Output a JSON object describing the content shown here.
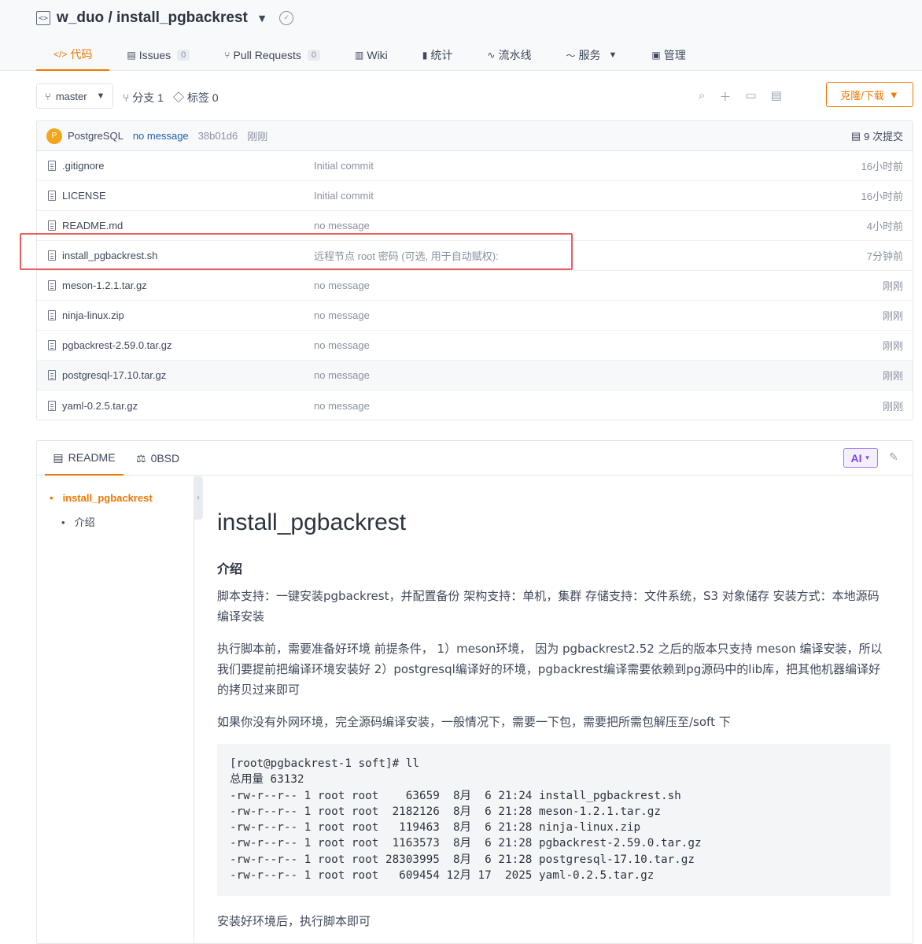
{
  "repo": {
    "title": "w_duo / install_pgbackrest"
  },
  "tabs": [
    {
      "label": "代码",
      "icon": "code-icon"
    },
    {
      "label": "Issues",
      "count": "0",
      "icon": "issue-icon"
    },
    {
      "label": "Pull Requests",
      "count": "0",
      "icon": "pull-request-icon"
    },
    {
      "label": "Wiki",
      "icon": "wiki-icon"
    },
    {
      "label": "统计",
      "icon": "chart-icon"
    },
    {
      "label": "流水线",
      "icon": "pipeline-icon"
    },
    {
      "label": "服务",
      "icon": "service-icon"
    },
    {
      "label": "管理",
      "icon": "manage-icon"
    }
  ],
  "toolbar": {
    "branch": "master",
    "branches": "分支 1",
    "tags": "标签 0",
    "clone": "克隆/下载"
  },
  "commit": {
    "avatar": "P",
    "author": "PostgreSQL",
    "message": "no message",
    "sha": "38b01d6",
    "time": "刚刚",
    "count": "9 次提交"
  },
  "files": [
    {
      "name": ".gitignore",
      "message": "Initial commit",
      "time": "16小时前"
    },
    {
      "name": "LICENSE",
      "message": "Initial commit",
      "time": "16小时前"
    },
    {
      "name": "README.md",
      "message": "no message",
      "time": "4小时前"
    },
    {
      "name": "install_pgbackrest.sh",
      "message": "远程节点 root 密码 (可选, 用于自动赋权):",
      "time": "7分钟前"
    },
    {
      "name": "meson-1.2.1.tar.gz",
      "message": "no message",
      "time": "刚刚"
    },
    {
      "name": "ninja-linux.zip",
      "message": "no message",
      "time": "刚刚"
    },
    {
      "name": "pgbackrest-2.59.0.tar.gz",
      "message": "no message",
      "time": "刚刚"
    },
    {
      "name": "postgresql-17.10.tar.gz",
      "message": "no message",
      "time": "刚刚"
    },
    {
      "name": "yaml-0.2.5.tar.gz",
      "message": "no message",
      "time": "刚刚"
    }
  ],
  "readme": {
    "tab_readme": "README",
    "tab_license": "0BSD",
    "ai": "AI",
    "toc": [
      "install_pgbackrest",
      "介绍"
    ],
    "title": "install_pgbackrest",
    "section": "介绍",
    "p1": "脚本支持：一键安装pgbackrest，并配置备份 架构支持：单机，集群 存储支持：文件系统，S3 对象储存 安装方式：本地源码编译安装",
    "p2": "执行脚本前，需要准备好环境 前提条件， 1）meson环境， 因为 pgbackrest2.52 之后的版本只支持 meson 编译安装，所以我们要提前把编译环境安装好 2）postgresql编译好的环境，pgbackrest编译需要依赖到pg源码中的lib库，把其他机器编译好的拷贝过来即可",
    "p3": "如果你没有外网环境，完全源码编译安装，一般情况下，需要一下包，需要把所需包解压至/soft 下",
    "code": "[root@pgbackrest-1 soft]# ll\n总用量 63132\n-rw-r--r-- 1 root root    63659  8月  6 21:24 install_pgbackrest.sh\n-rw-r--r-- 1 root root  2182126  8月  6 21:28 meson-1.2.1.tar.gz\n-rw-r--r-- 1 root root   119463  8月  6 21:28 ninja-linux.zip\n-rw-r--r-- 1 root root  1163573  8月  6 21:28 pgbackrest-2.59.0.tar.gz\n-rw-r--r-- 1 root root 28303995  8月  6 21:28 postgresql-17.10.tar.gz\n-rw-r--r-- 1 root root   609454 12月 17  2025 yaml-0.2.5.tar.gz",
    "p4": "安装好环境后，执行脚本即可"
  }
}
